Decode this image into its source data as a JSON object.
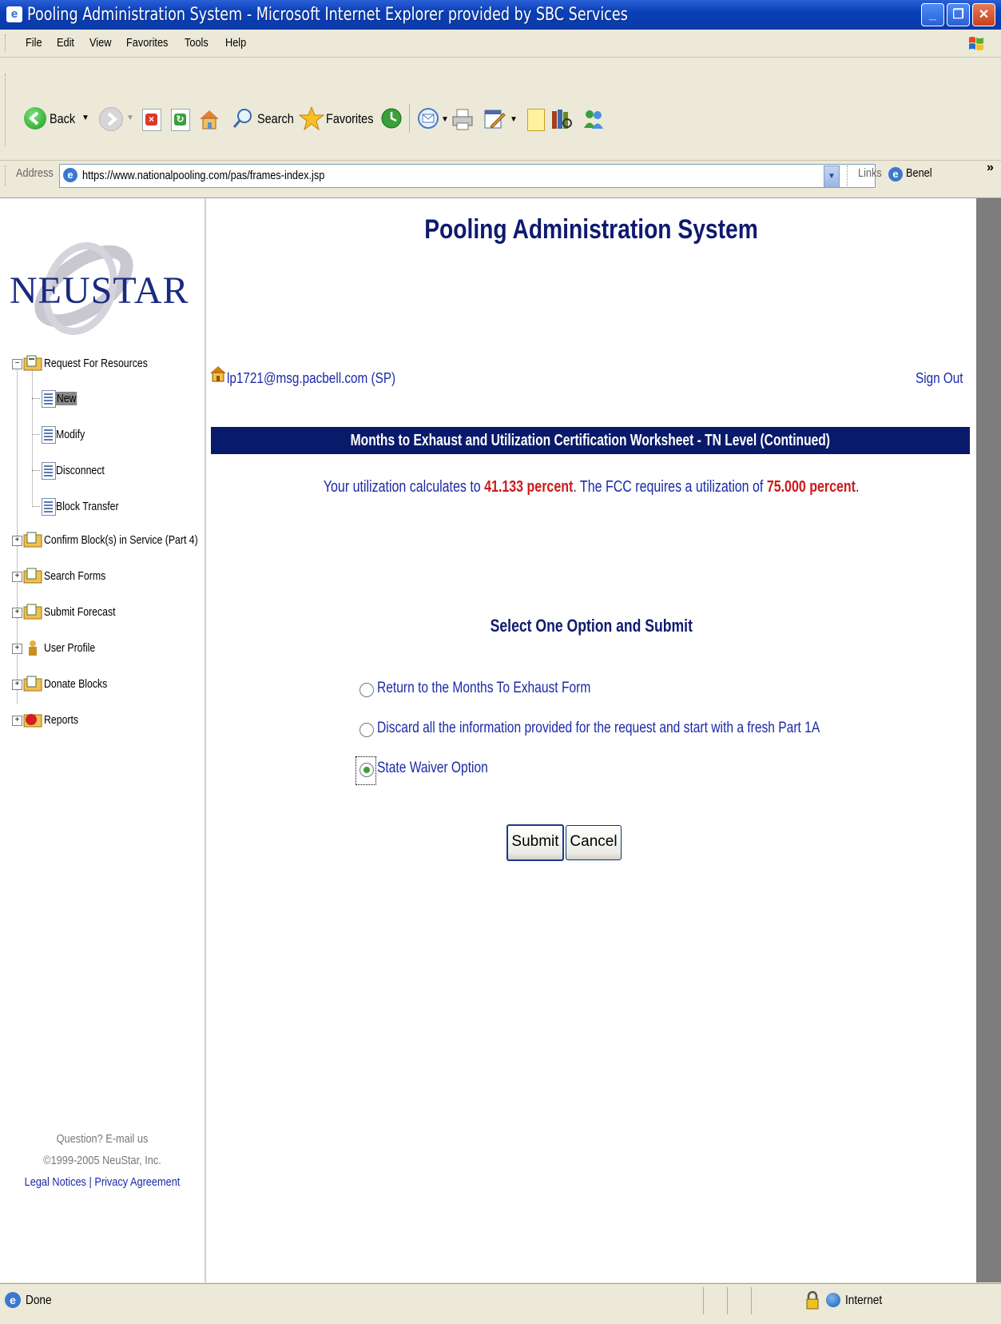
{
  "window": {
    "title": "Pooling Administration System - Microsoft Internet Explorer provided by SBC Services",
    "icon": "ie-icon",
    "controls": [
      "minimize",
      "maximize",
      "close"
    ]
  },
  "menu": [
    "File",
    "Edit",
    "View",
    "Favorites",
    "Tools",
    "Help"
  ],
  "toolbar": {
    "back_label": "Back",
    "search_label": "Search",
    "favorites_label": "Favorites"
  },
  "address": {
    "label": "Address",
    "url": "https://www.nationalpooling.com/pas/frames-index.jsp",
    "links_label": "Links",
    "links_item": "Benel",
    "chevron": "»"
  },
  "sidebar": {
    "logo_text": "NEUSTAR",
    "tree": [
      {
        "label": "Request For Resources",
        "expander": "−",
        "children": [
          "New",
          "Modify",
          "Disconnect",
          "Block Transfer"
        ]
      },
      {
        "label": "Confirm Block(s) in Service (Part 4)",
        "expander": "+"
      },
      {
        "label": "Search Forms",
        "expander": "+"
      },
      {
        "label": "Submit Forecast",
        "expander": "+"
      },
      {
        "label": "User Profile",
        "expander": "+"
      },
      {
        "label": "Donate Blocks",
        "expander": "+"
      },
      {
        "label": "Reports",
        "expander": "+"
      }
    ],
    "footer": {
      "question": "Question? E-mail us",
      "copyright": "©1999-2005 NeuStar, Inc.",
      "legal": "Legal Notices",
      "separator": "|",
      "privacy": "Privacy Agreement"
    }
  },
  "main": {
    "title": "Pooling Administration System",
    "user": "lp1721@msg.pacbell.com (SP)",
    "sign_out": "Sign Out",
    "banner": "Months to Exhaust and Utilization Certification Worksheet - TN Level (Continued)",
    "util_prefix": "Your utilization calculates to ",
    "util_value": "41.133 percent",
    "util_middle": ". The FCC requires a utilization of ",
    "fcc_value": "75.000 percent",
    "util_suffix": ".",
    "select_heading": "Select One Option and Submit",
    "options": [
      {
        "label": "Return to the Months To Exhaust Form",
        "checked": false
      },
      {
        "label": "Discard all the information provided for the request and start with a fresh Part 1A",
        "checked": false
      },
      {
        "label": "State Waiver Option",
        "checked": true
      }
    ],
    "submit_label": "Submit",
    "cancel_label": "Cancel"
  },
  "status": {
    "text": "Done",
    "zone": "Internet"
  },
  "colors": {
    "title_blue": "#0f1a6e",
    "banner_bg": "#0a1a6a",
    "link_blue": "#1a2aa8",
    "value_red": "#cc1a1a"
  }
}
